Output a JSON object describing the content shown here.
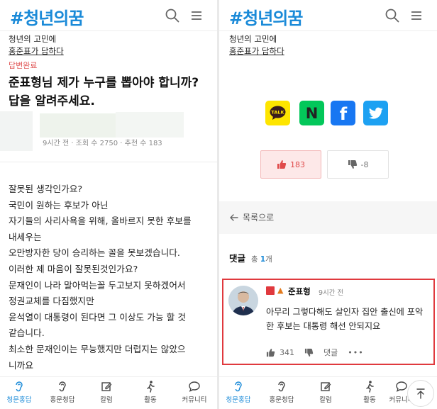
{
  "brand": {
    "logo": "#청년의꿈",
    "color": "#1a8ad8"
  },
  "left": {
    "breadcrumb": {
      "line1": "청년의 고민에",
      "line2": "홍준표가 답하다"
    },
    "status": "답변완료",
    "question_title": "준표형님 제가 누구를 뽑아야 합니까? 답을 알려주세요.",
    "meta": "9시간 전  ·  조회 수 2750  ·  추천 수 183",
    "body": [
      "잘못된 생각인가요?",
      "국민이 원하는 후보가 아닌",
      "자기들의 사리사욕을 위해, 올바르지 못한 후보를",
      "내세우는",
      "오만방자한 당이 승리하는 꼴을 못보겠습니다.",
      "이러한 제 마음이 잘못된것인가요?",
      "",
      "문재인이 나라 말아먹는꼴 두고보지 못하겠어서",
      "정권교체를 다짐했지만",
      "윤석열이 대통령이 된다면 그 이상도 가능 할 것",
      "같습니다.",
      "최소한 문재인이는 무능했지만 더럽지는 않았으",
      "니까요"
    ]
  },
  "right": {
    "breadcrumb": {
      "line1": "청년의 고민에",
      "line2": "홍준표가 답하다"
    },
    "share": [
      {
        "name": "kakaotalk",
        "label": "TALK",
        "color": "#fee500"
      },
      {
        "name": "naver",
        "label": "N",
        "color": "#03c75a"
      },
      {
        "name": "facebook",
        "label": "f",
        "color": "#1877f2"
      },
      {
        "name": "twitter",
        "label": "",
        "color": "#1da1f2"
      }
    ],
    "votes": {
      "up": "183",
      "down": "-8"
    },
    "back_label": "목록으로",
    "comments": {
      "label": "댓글",
      "total_prefix": "총",
      "count": "1",
      "total_suffix": "개",
      "items": [
        {
          "author": "준표형",
          "time": "9시간 전",
          "text": "아무리 그렇다해도 살인자 집안 출신에 포악한 후보는 대통령 해선 안되지요",
          "likes": "341",
          "reply_label": "댓글",
          "more": "•••"
        }
      ]
    }
  },
  "nav": [
    {
      "label": "청문홍답",
      "icon": "ear-icon",
      "active": true
    },
    {
      "label": "홍문청답",
      "icon": "ear-icon",
      "active": false
    },
    {
      "label": "칼럼",
      "icon": "pencil-icon",
      "active": false
    },
    {
      "label": "활동",
      "icon": "walking-icon",
      "active": false
    },
    {
      "label": "커뮤니티",
      "icon": "chat-icon",
      "active": false
    }
  ]
}
